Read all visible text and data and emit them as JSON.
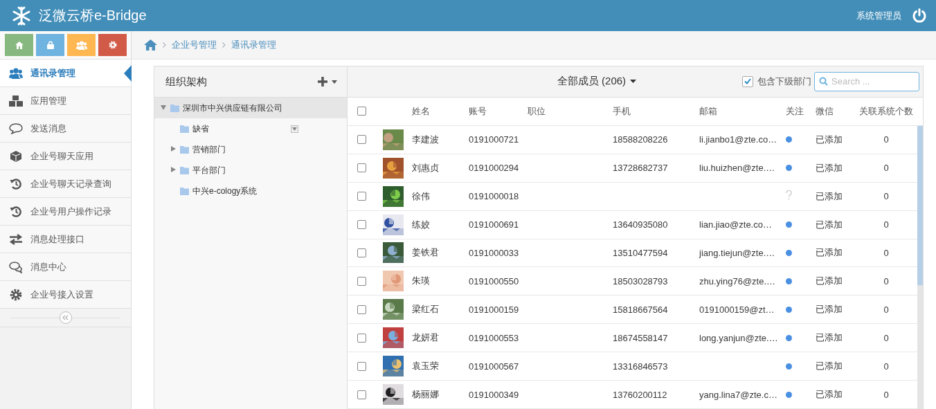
{
  "header": {
    "title": "泛微云桥e-Bridge",
    "user": "系统管理员"
  },
  "quick_buttons": [
    {
      "kind": "home",
      "color": "#87b87f"
    },
    {
      "kind": "lock",
      "color": "#6fb3e0"
    },
    {
      "kind": "users",
      "color": "#ffb752"
    },
    {
      "kind": "gear",
      "color": "#d15b47"
    }
  ],
  "sidebar": {
    "items": [
      {
        "label": "通讯录管理",
        "selected": true
      },
      {
        "label": "应用管理",
        "selected": false
      },
      {
        "label": "发送消息",
        "selected": false
      },
      {
        "label": "企业号聊天应用",
        "selected": false
      },
      {
        "label": "企业号聊天记录查询",
        "selected": false
      },
      {
        "label": "企业号用户操作记录",
        "selected": false
      },
      {
        "label": "消息处理接口",
        "selected": false
      },
      {
        "label": "消息中心",
        "selected": false
      },
      {
        "label": "企业号接入设置",
        "selected": false
      }
    ]
  },
  "breadcrumb": [
    "企业号管理",
    "通讯录管理"
  ],
  "org_panel": {
    "title": "组织架构",
    "tree": [
      {
        "label": "深圳市中兴供应链有限公司",
        "expanded": true,
        "selected": true,
        "children": [
          {
            "label": "缺省",
            "has_children": false,
            "selected": false,
            "menu": true
          },
          {
            "label": "营销部门",
            "has_children": true,
            "selected": false,
            "menu": false
          },
          {
            "label": "平台部门",
            "has_children": true,
            "selected": false,
            "menu": false
          },
          {
            "label": "中兴e-cology系统",
            "has_children": false,
            "selected": false,
            "menu": false
          }
        ]
      }
    ]
  },
  "members": {
    "title": "全部成员 (206)",
    "include_sub": {
      "label": "包含下级部门",
      "checked": true
    },
    "search": {
      "placeholder": "Search ..."
    },
    "select_all_checked": false,
    "columns": [
      "姓名",
      "账号",
      "职位",
      "手机",
      "邮箱",
      "关注",
      "微信",
      "关联系统个数"
    ],
    "rows": [
      {
        "checked": false,
        "name": "李建波",
        "account": "0191000721",
        "phone": "18588208226",
        "email": "li.jianbo1@zte.co…",
        "followed": true,
        "wechat": "已添加",
        "count": "0"
      },
      {
        "checked": false,
        "name": "刘惠贞",
        "account": "0191000294",
        "phone": "13728682737",
        "email": "liu.huizhen@zte.…",
        "followed": true,
        "wechat": "已添加",
        "count": "0"
      },
      {
        "checked": false,
        "name": "徐伟",
        "account": "0191000018",
        "followed": false,
        "wechat": "已添加",
        "count": "0"
      },
      {
        "checked": false,
        "name": "练姣",
        "account": "0191000691",
        "phone": "13640935080",
        "email": "lian.jiao@zte.co…",
        "followed": true,
        "wechat": "已添加",
        "count": "0"
      },
      {
        "checked": false,
        "name": "姜铁君",
        "account": "0191000033",
        "phone": "13510477594",
        "email": "jiang.tiejun@zte.…",
        "followed": true,
        "wechat": "已添加",
        "count": "0"
      },
      {
        "checked": false,
        "name": "朱瑛",
        "account": "0191000550",
        "phone": "18503028793",
        "email": "zhu.ying76@zte.…",
        "followed": true,
        "wechat": "已添加",
        "count": "0"
      },
      {
        "checked": false,
        "name": "梁红石",
        "account": "0191000159",
        "phone": "15818667564",
        "email": "0191000159@zt…",
        "followed": true,
        "wechat": "已添加",
        "count": "0"
      },
      {
        "checked": false,
        "name": "龙妍君",
        "account": "0191000553",
        "phone": "18674558147",
        "email": "long.yanjun@zte.…",
        "followed": true,
        "wechat": "已添加",
        "count": "0"
      },
      {
        "checked": false,
        "name": "袁玉荣",
        "account": "0191000567",
        "phone": "13316846573",
        "followed": true,
        "wechat": "已添加",
        "count": "0"
      },
      {
        "checked": false,
        "name": "杨丽娜",
        "account": "0191000349",
        "phone": "13760200112",
        "email": "yang.lina7@zte.c…",
        "followed": true,
        "wechat": "已添加",
        "count": "0"
      }
    ]
  }
}
